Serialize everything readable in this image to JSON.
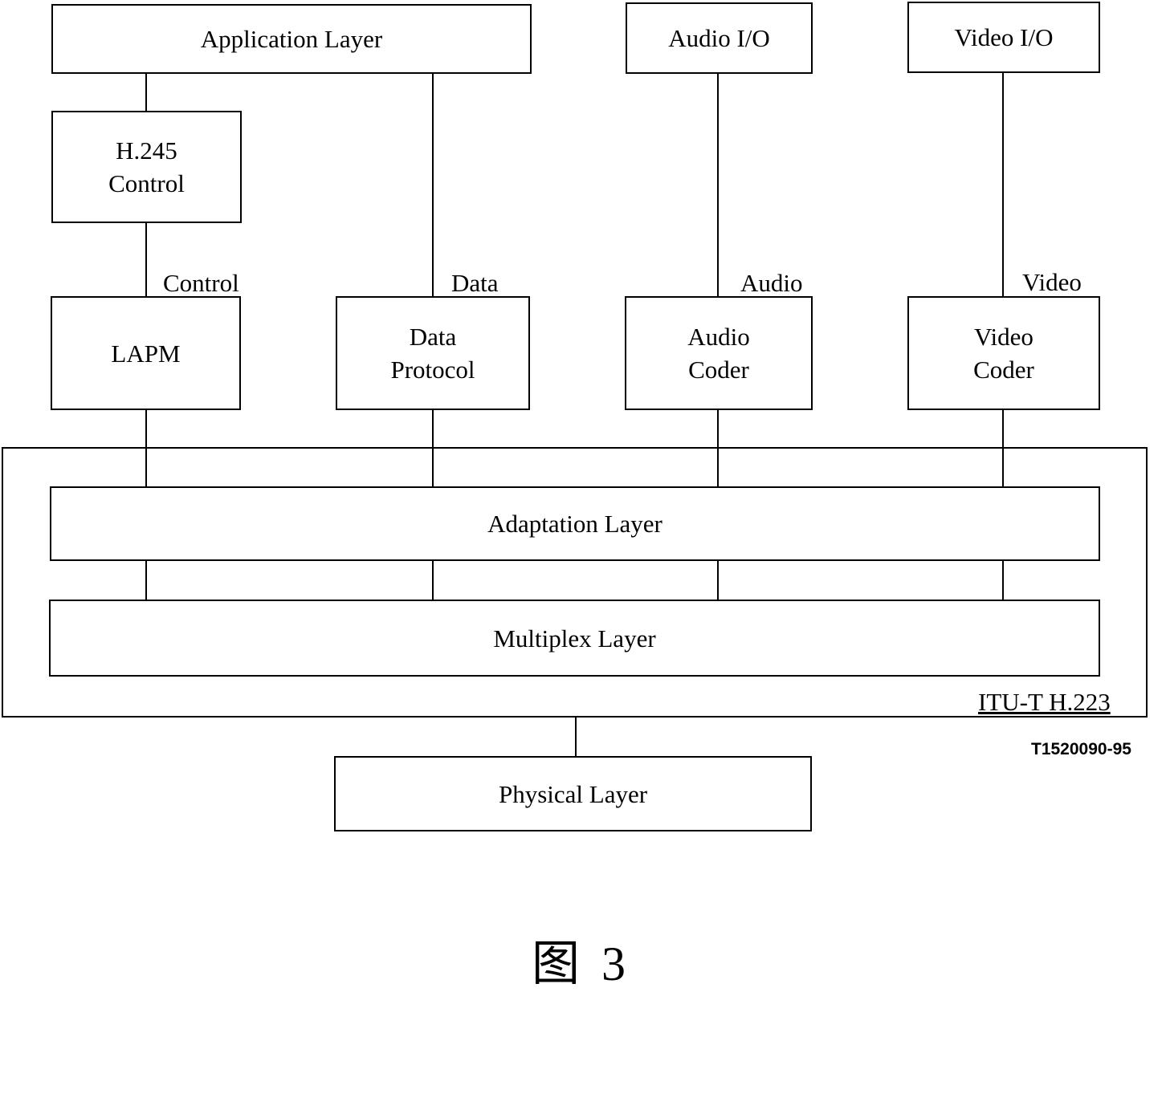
{
  "boxes": {
    "application_layer": "Application Layer",
    "audio_io": "Audio I/O",
    "video_io": "Video I/O",
    "h245_control": [
      "H.245",
      "Control"
    ],
    "lapm": "LAPM",
    "data_protocol": [
      "Data",
      "Protocol"
    ],
    "audio_coder": [
      "Audio",
      "Coder"
    ],
    "video_coder": [
      "Video",
      "Coder"
    ],
    "adaptation_layer": "Adaptation Layer",
    "multiplex_layer": "Multiplex Layer",
    "physical_layer": "Physical Layer"
  },
  "line_labels": {
    "control": "Control",
    "data": "Data",
    "audio": "Audio",
    "video": "Video"
  },
  "group_label": "ITU-T H.223",
  "figure_id": "T1520090-95",
  "caption": "图 3"
}
